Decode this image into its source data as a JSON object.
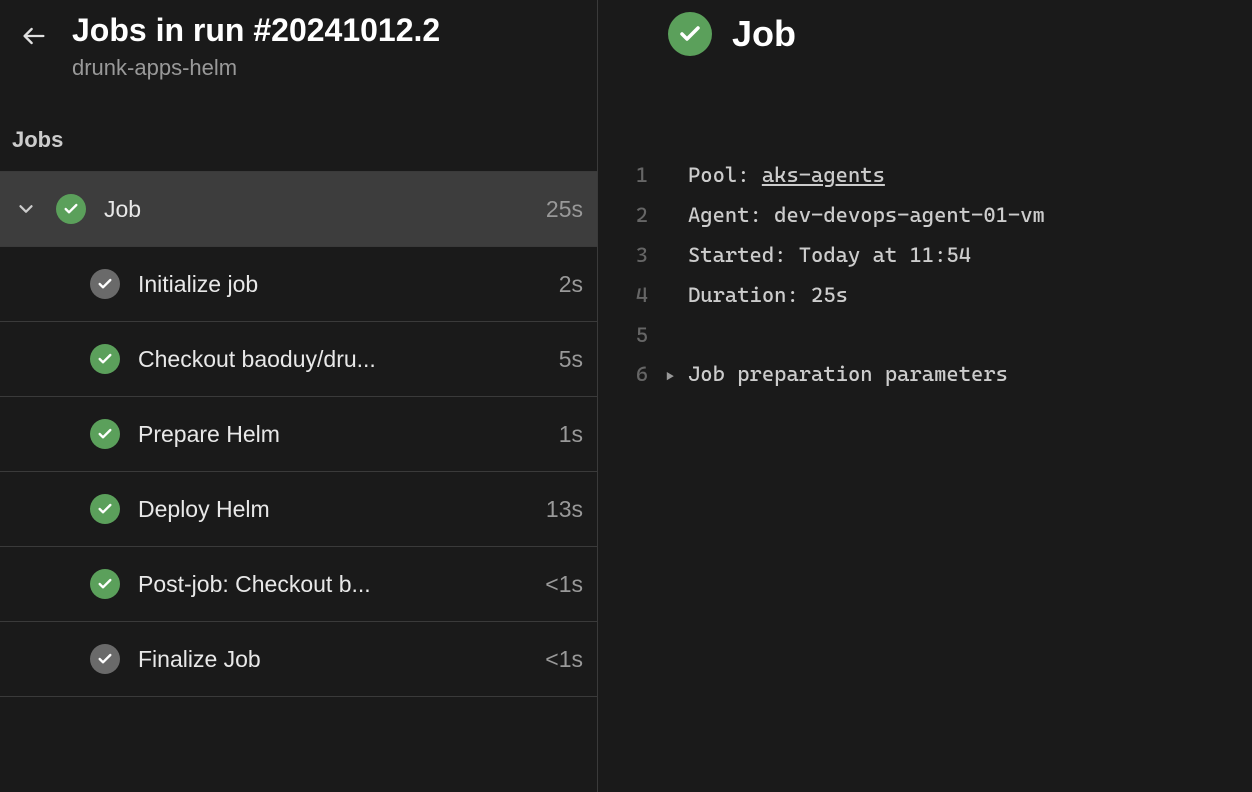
{
  "header": {
    "title": "Jobs in run #20241012.2",
    "subtitle": "drunk-apps-helm"
  },
  "jobsSectionLabel": "Jobs",
  "mainJob": {
    "name": "Job",
    "duration": "25s",
    "status": "success"
  },
  "steps": [
    {
      "name": "Initialize job",
      "duration": "2s",
      "status": "neutral"
    },
    {
      "name": "Checkout baoduy/dru...",
      "duration": "5s",
      "status": "success"
    },
    {
      "name": "Prepare Helm",
      "duration": "1s",
      "status": "success"
    },
    {
      "name": "Deploy Helm",
      "duration": "13s",
      "status": "success"
    },
    {
      "name": "Post-job: Checkout b...",
      "duration": "<1s",
      "status": "success"
    },
    {
      "name": "Finalize Job",
      "duration": "<1s",
      "status": "neutral"
    }
  ],
  "detail": {
    "title": "Job",
    "status": "success"
  },
  "log": {
    "lines": [
      {
        "num": "1",
        "label": "Pool: ",
        "value": "aks-agents",
        "link": true
      },
      {
        "num": "2",
        "label": "Agent: ",
        "value": "dev-devops-agent-01-vm",
        "link": false
      },
      {
        "num": "3",
        "label": "Started: ",
        "value": "Today at 11:54",
        "link": false
      },
      {
        "num": "4",
        "label": "Duration: ",
        "value": "25s",
        "link": false
      },
      {
        "num": "5",
        "label": "",
        "value": "",
        "link": false
      },
      {
        "num": "6",
        "label": "Job preparation parameters",
        "value": "",
        "link": false,
        "expandable": true
      }
    ]
  }
}
